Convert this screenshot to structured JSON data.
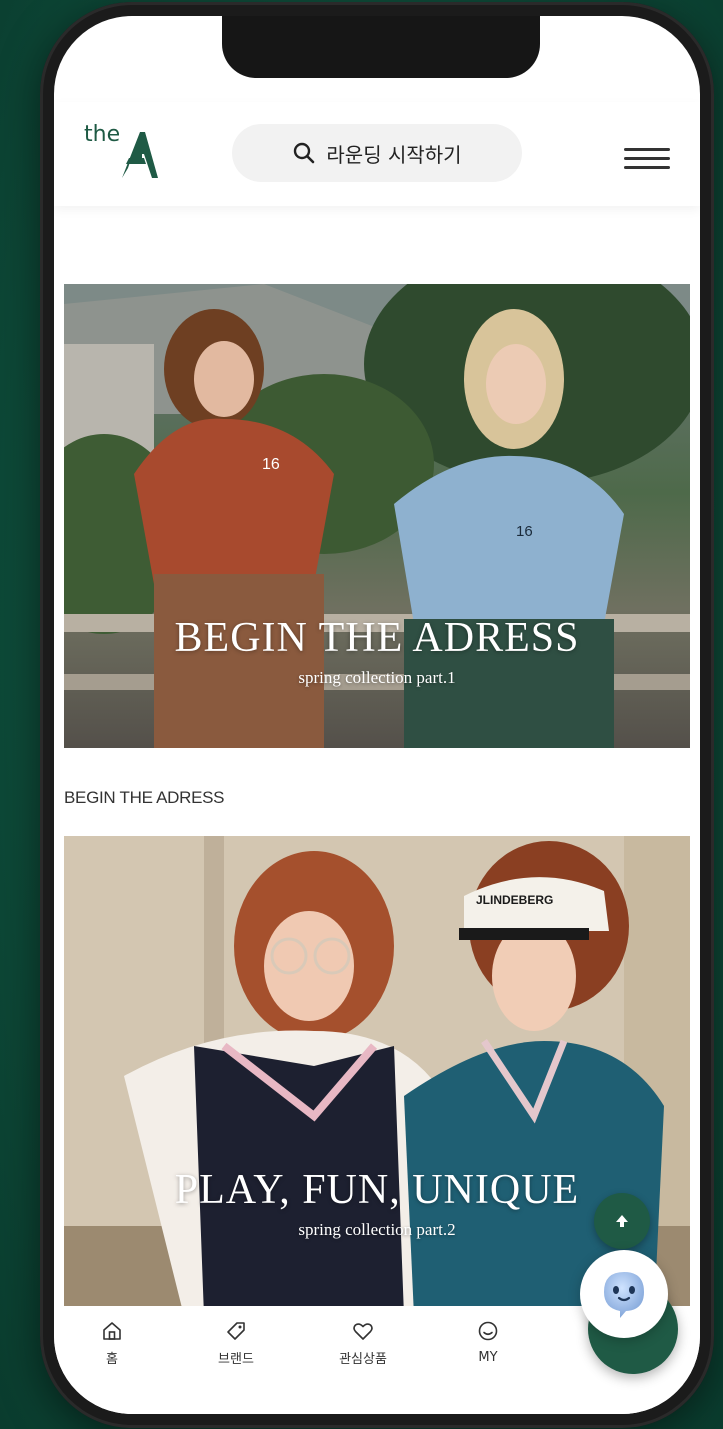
{
  "header": {
    "logo_text": "the",
    "search_label": "라운딩 시작하기",
    "search_icon": "search-icon",
    "menu_icon": "hamburger-menu-icon"
  },
  "banners": [
    {
      "title": "BEGIN THE ADRESS",
      "subtitle": "spring collection part.1",
      "shirt_number": "16"
    },
    {
      "title": "PLAY, FUN, UNIQUE",
      "subtitle": "spring collection part.2",
      "visor_text": "JLINDEBERG"
    }
  ],
  "section_label": "BEGIN THE ADRESS",
  "nav": {
    "items": [
      {
        "label": "홈",
        "icon": "home-icon"
      },
      {
        "label": "브랜드",
        "icon": "tag-icon"
      },
      {
        "label": "관심상품",
        "icon": "heart-icon"
      },
      {
        "label": "MY",
        "icon": "smile-icon"
      }
    ]
  },
  "fabs": {
    "scroll_top_icon": "arrow-up-icon",
    "chatbot_icon": "chatbot-icon"
  },
  "colors": {
    "brand": "#1f5a45",
    "background": "#0f4f3c"
  }
}
